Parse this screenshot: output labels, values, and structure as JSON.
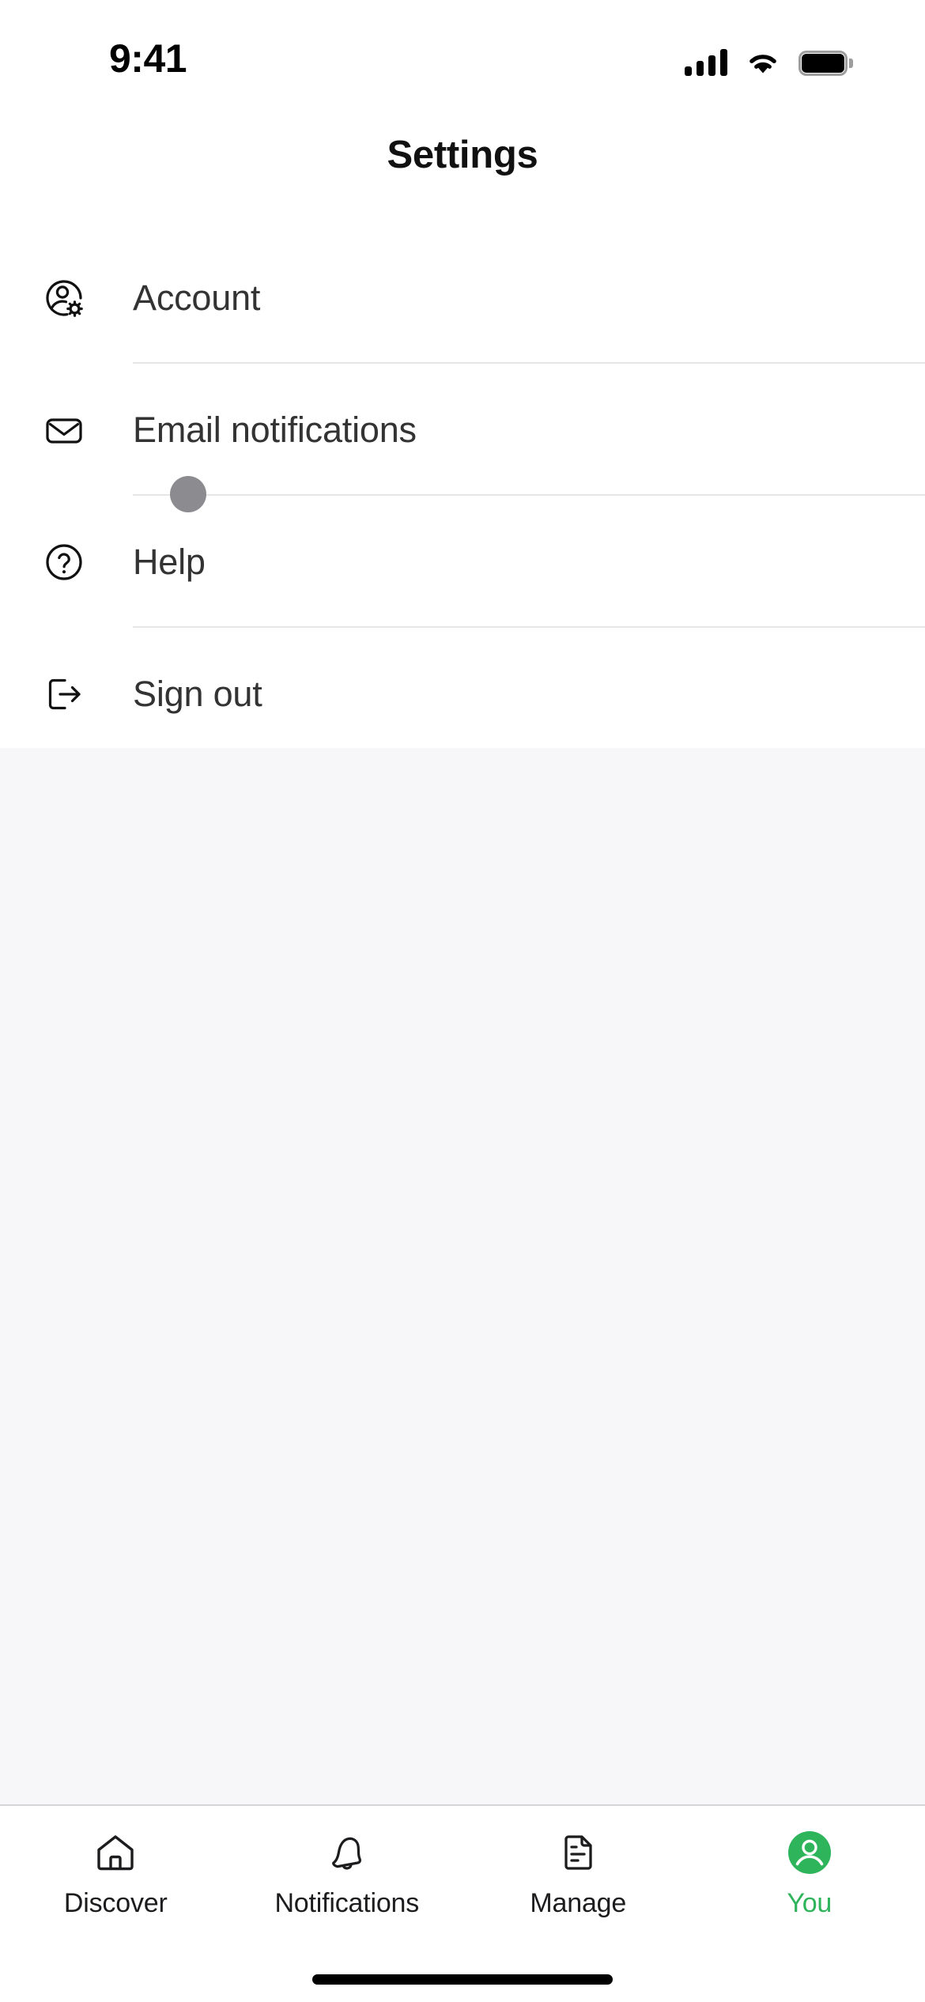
{
  "status_bar": {
    "time": "9:41",
    "signal_icon": "cellular-signal-icon",
    "signal_bars": 4,
    "wifi_icon": "wifi-icon",
    "battery_icon": "battery-full-icon"
  },
  "header": {
    "title": "Settings"
  },
  "settings": {
    "rows": [
      {
        "id": "account",
        "label": "Account",
        "icon": "account-gear-icon"
      },
      {
        "id": "email-notifications",
        "label": "Email notifications",
        "icon": "envelope-icon"
      },
      {
        "id": "help",
        "label": "Help",
        "icon": "question-circle-icon"
      },
      {
        "id": "sign-out",
        "label": "Sign out",
        "icon": "sign-out-icon"
      }
    ]
  },
  "tap_indicator": {
    "visible": true,
    "color": "#8b8b90"
  },
  "tab_bar": {
    "active": "you",
    "accent_color": "#2eb45a",
    "tabs": [
      {
        "id": "discover",
        "label": "Discover",
        "icon": "home-icon"
      },
      {
        "id": "notifications",
        "label": "Notifications",
        "icon": "bell-icon"
      },
      {
        "id": "manage",
        "label": "Manage",
        "icon": "document-icon"
      },
      {
        "id": "you",
        "label": "You",
        "icon": "avatar-person-icon"
      }
    ]
  },
  "colors": {
    "accent": "#2eb45a",
    "content_background": "#f7f6f9",
    "divider": "#e6e6e6",
    "text_primary": "#333333"
  }
}
